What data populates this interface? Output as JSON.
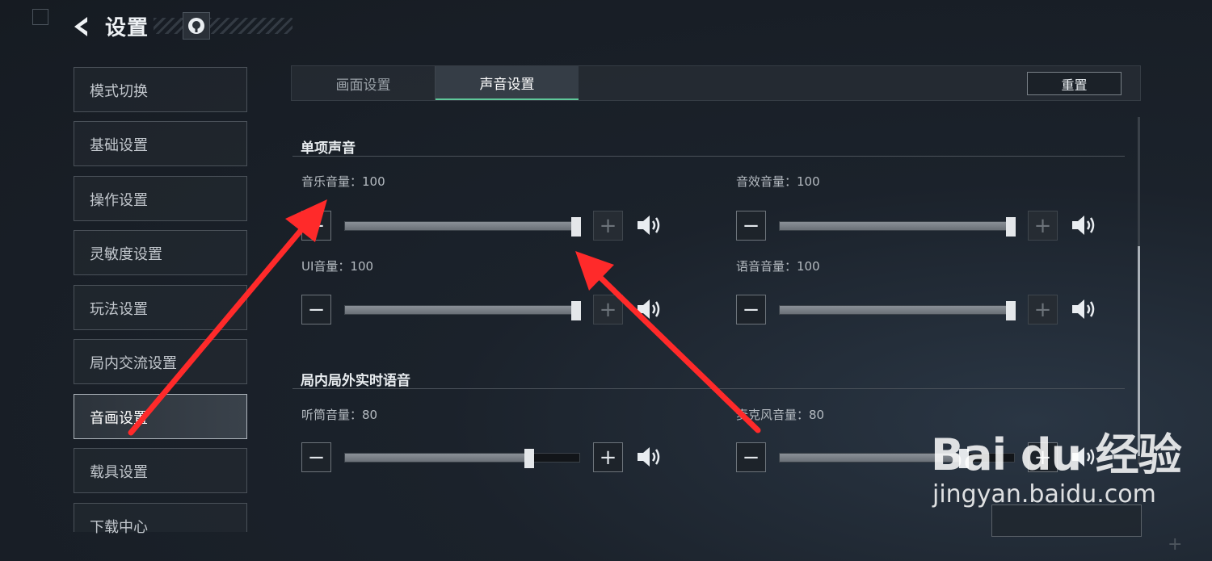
{
  "header": {
    "title": "设置"
  },
  "sidebar": {
    "items": [
      {
        "label": "模式切换"
      },
      {
        "label": "基础设置"
      },
      {
        "label": "操作设置"
      },
      {
        "label": "灵敏度设置"
      },
      {
        "label": "玩法设置"
      },
      {
        "label": "局内交流设置"
      },
      {
        "label": "音画设置"
      },
      {
        "label": "载具设置"
      },
      {
        "label": "下载中心"
      }
    ],
    "active_index": 6
  },
  "tabs": [
    {
      "label": "画面设置"
    },
    {
      "label": "声音设置"
    }
  ],
  "active_tab": 1,
  "reset_label": "重置",
  "sections": [
    {
      "title": "单项声音",
      "sliders": [
        {
          "label": "音乐音量：100",
          "value": 100
        },
        {
          "label": "音效音量：100",
          "value": 100
        },
        {
          "label": "UI音量：100",
          "value": 100
        },
        {
          "label": "语音音量：100",
          "value": 100
        }
      ]
    },
    {
      "title": "局内局外实时语音",
      "sliders": [
        {
          "label": "听筒音量：80",
          "value": 80
        },
        {
          "label": "麦克风音量：80",
          "value": 80
        }
      ]
    }
  ],
  "bottom_button": {
    "label": ""
  },
  "watermark": {
    "logo": "Bai du 经验",
    "url": "jingyan.baidu.com"
  },
  "colors": {
    "accent": "#5fc89a",
    "arrow": "#ff2a2a",
    "background": "#1b222b"
  },
  "icons": {
    "back": "back-arrow-icon",
    "help": "help-icon",
    "speaker": "speaker-icon",
    "minus": "minus-icon",
    "plus": "plus-icon"
  }
}
